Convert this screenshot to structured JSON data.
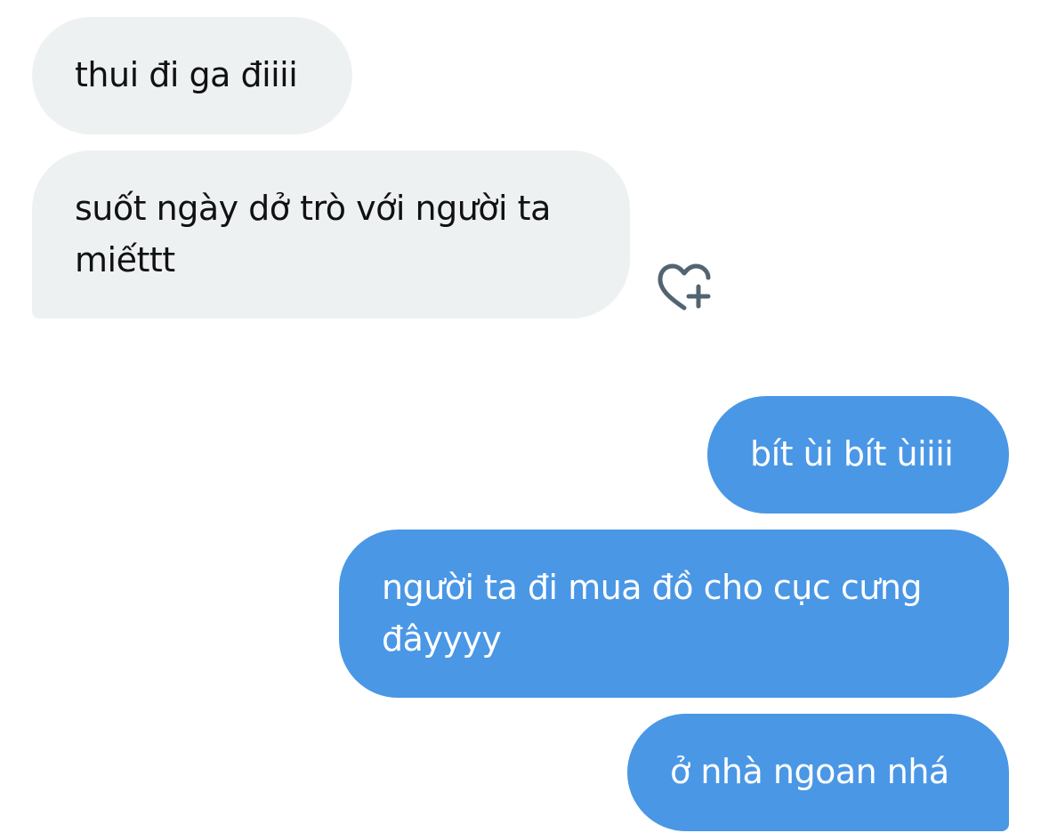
{
  "conversation": {
    "messages": [
      {
        "direction": "incoming",
        "lines": [
          "thui đi ga điiii"
        ]
      },
      {
        "direction": "incoming",
        "lines": [
          "suốt ngày dở trò với người ta",
          "miếttt"
        ]
      },
      {
        "direction": "outgoing",
        "lines": [
          "bít ùi bít ùiiii"
        ]
      },
      {
        "direction": "outgoing",
        "lines": [
          "người ta đi mua đồ cho cục cưng",
          "đâyyyy"
        ]
      },
      {
        "direction": "outgoing",
        "lines": [
          "ở nhà ngoan nhá"
        ]
      }
    ]
  },
  "reaction": {
    "icon": "heart-plus-icon"
  },
  "colors": {
    "incoming_bubble": "#eef1f2",
    "incoming_text": "#111111",
    "outgoing_bubble": "#4a97e6",
    "outgoing_text": "#ffffff",
    "icon": "#536471"
  }
}
